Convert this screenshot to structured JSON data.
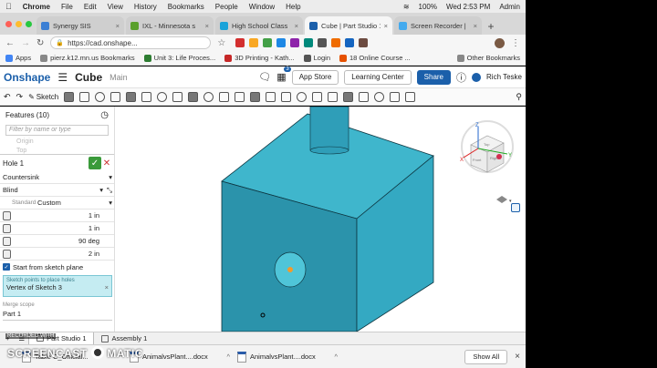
{
  "menubar": {
    "apple": "",
    "items": [
      "Chrome",
      "File",
      "Edit",
      "View",
      "History",
      "Bookmarks",
      "People",
      "Window",
      "Help"
    ],
    "battery": "100%",
    "clock": "Wed 2:53 PM",
    "user": "Admin"
  },
  "tabs": [
    {
      "title": "Synergy SIS",
      "color": "#3b7fd4"
    },
    {
      "title": "IXL - Minnesota s",
      "color": "#5aa02c"
    },
    {
      "title": "High School Class",
      "color": "#1aa3d9"
    },
    {
      "title": "Cube | Part Studio 1",
      "color": "#1b5faa",
      "active": true
    },
    {
      "title": "Screen Recorder |",
      "color": "#44aaee"
    }
  ],
  "addressbar": {
    "url": "https://cad.onshape..."
  },
  "bookmarks": [
    {
      "label": "Apps",
      "color": "#4285f4"
    },
    {
      "label": "pierz.k12.mn.us Bookmarks",
      "color": "#888888"
    },
    {
      "label": "Unit 3: Life Proces...",
      "color": "#2e7d32"
    },
    {
      "label": "3D Printing - Kath...",
      "color": "#c62828"
    },
    {
      "label": "Login",
      "color": "#555555"
    },
    {
      "label": "18 Online Course ...",
      "color": "#e65100"
    }
  ],
  "bookmarks_other": "Other Bookmarks",
  "onshape": {
    "logo": "Onshape",
    "doc_name": "Cube",
    "workspace": "Main",
    "notif_count": "3",
    "app_store": "App Store",
    "learning_center": "Learning Center",
    "share": "Share",
    "user": "Rich Teske",
    "sketch": "Sketch"
  },
  "features": {
    "header": "Features (10)",
    "filter_placeholder": "Filter by name or type",
    "ghost_items": [
      "Origin",
      "Top"
    ],
    "hole": {
      "title": "Hole 1",
      "style": "Countersink",
      "termination": "Blind",
      "standard_label": "Standard",
      "standard_value": "Custom",
      "dims": [
        "1 in",
        "1 in",
        "90 deg",
        "2 in"
      ],
      "start_label": "Start from sketch plane",
      "place_label": "Sketch points to place holes",
      "place_value": "Vertex of Sketch 3",
      "merge_label": "Merge scope",
      "merge_value": "Part 1"
    }
  },
  "viewcube": {
    "z": "Z",
    "x": "X",
    "y": "Y",
    "front": "Front",
    "right": "Right",
    "top": "Top"
  },
  "bottom_tabs": [
    {
      "label": "Part Studio 1",
      "active": true
    },
    {
      "label": "Assembly 1",
      "active": false
    }
  ],
  "downloads": [
    {
      "name": "Table C_Official..."
    },
    {
      "name": "AnimalvsPlant....docx"
    },
    {
      "name": "AnimalvsPlant....docx"
    }
  ],
  "show_all": "Show All",
  "watermark": {
    "recorded": "RECORDED WITH",
    "brand_pre": "SCREENCAST",
    "brand_post": "MATIC"
  },
  "colors": {
    "onshape_blue": "#1b5faa",
    "cube_top": "#3fb6cc",
    "cube_front": "#2b93ab",
    "cube_right": "#34a9c2",
    "place_highlight": "#c5ecf2"
  }
}
